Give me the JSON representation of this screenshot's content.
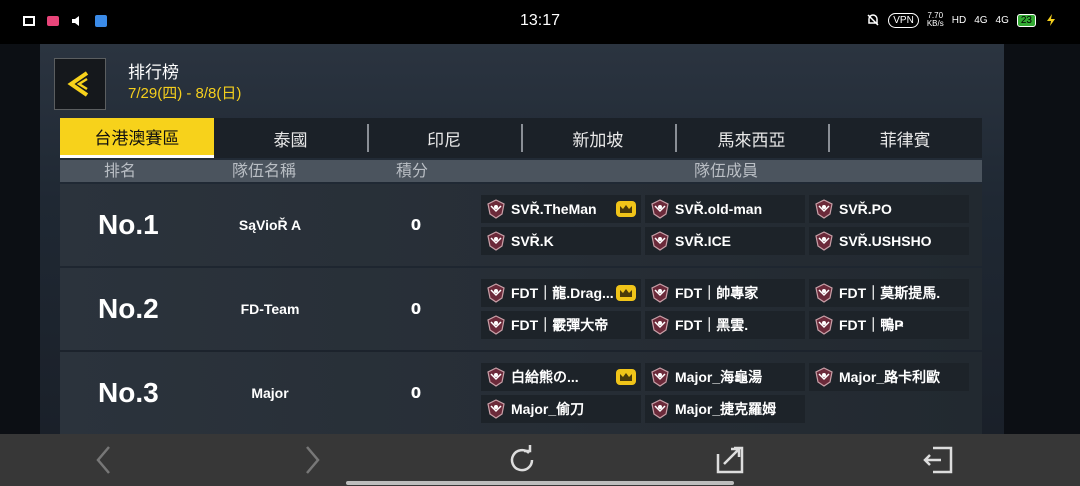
{
  "status_bar": {
    "time": "13:17",
    "vpn": "VPN",
    "speed_top": "7.70",
    "speed_bottom": "KB/s",
    "hd": "HD",
    "signal1": "4G",
    "signal2": "4G",
    "battery": "23"
  },
  "header": {
    "title": "排行榜",
    "date_range": "7/29(四) - 8/8(日)"
  },
  "tabs": [
    "台港澳賽區",
    "泰國",
    "印尼",
    "新加坡",
    "馬來西亞",
    "菲律賓"
  ],
  "active_tab": 0,
  "columns": {
    "rank": "排名",
    "team": "隊伍名稱",
    "score": "積分",
    "members": "隊伍成員"
  },
  "rows": [
    {
      "rank": "No.1",
      "team": "SąVioŘ A",
      "score": "0",
      "members": [
        "SVŘ.TheMan",
        "SVŘ.old-man",
        "SVŘ.PO",
        "SVŘ.K",
        "SVŘ.ICE",
        "SVŘ.USHSHO"
      ]
    },
    {
      "rank": "No.2",
      "team": "FD-Team",
      "score": "0",
      "members": [
        "FDT｜龍.Drag...",
        "FDT｜帥專家",
        "FDT｜莫斯提馬.",
        "FDT｜霰彈大帝",
        "FDT｜黑雲.",
        "FDT｜鴨Ҏ"
      ]
    },
    {
      "rank": "No.3",
      "team": "Major",
      "score": "0",
      "members": [
        "白給熊の...",
        "Major_海龜湯",
        "Major_路卡利歐",
        "Major_偷刀",
        "Major_捷克羅姆"
      ]
    }
  ],
  "colors": {
    "accent": "#f7d21b",
    "panel": "#1f2833",
    "row": "#2b333c",
    "member_bg": "#1d2329"
  },
  "icons": [
    "back-arrow-icon",
    "team-emblem-icon",
    "captain-crown-icon",
    "nav-back-icon",
    "nav-forward-icon",
    "refresh-icon",
    "share-icon",
    "exit-icon"
  ]
}
